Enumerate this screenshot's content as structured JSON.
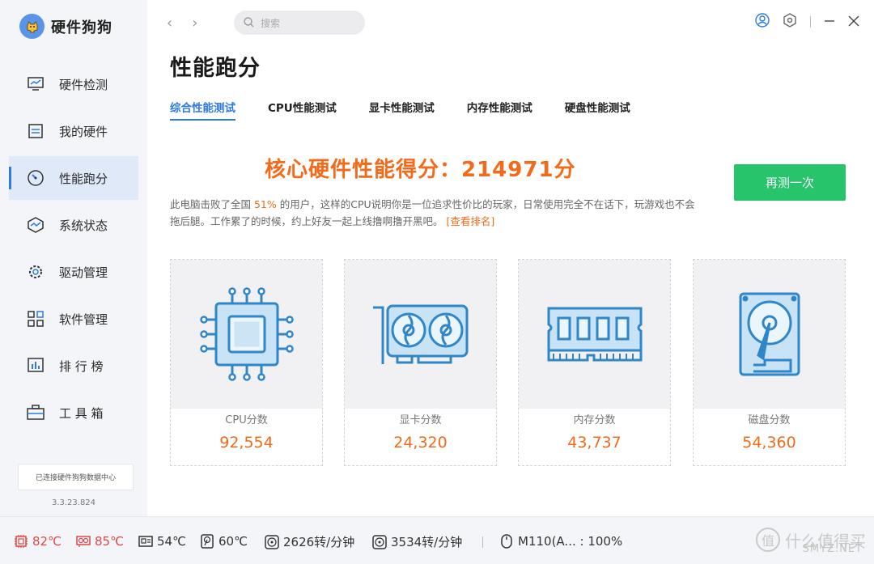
{
  "app": {
    "name": "硬件狗狗",
    "version": "3.3.23.824",
    "connection_status": "已连接硬件狗狗数据中心"
  },
  "sidebar": {
    "items": [
      {
        "label": "硬件检测",
        "icon": "monitor-chart-icon"
      },
      {
        "label": "我的硬件",
        "icon": "hardware-board-icon"
      },
      {
        "label": "性能跑分",
        "icon": "speedometer-icon",
        "active": true
      },
      {
        "label": "系统状态",
        "icon": "system-status-icon"
      },
      {
        "label": "驱动管理",
        "icon": "gear-icon"
      },
      {
        "label": "软件管理",
        "icon": "apps-grid-icon"
      },
      {
        "label": "排 行 榜",
        "icon": "bar-chart-icon"
      },
      {
        "label": "工 具 箱",
        "icon": "toolbox-icon"
      }
    ]
  },
  "topbar": {
    "search_placeholder": "搜索"
  },
  "main": {
    "title": "性能跑分",
    "tabs": [
      {
        "label": "综合性能测试",
        "active": true
      },
      {
        "label": "CPU性能测试"
      },
      {
        "label": "显卡性能测试"
      },
      {
        "label": "内存性能测试"
      },
      {
        "label": "硬盘性能测试"
      }
    ],
    "score_headline": "核心硬件性能得分：214971分",
    "retest_label": "再测一次",
    "desc_prefix": "此电脑击败了全国 ",
    "desc_percent": "51%",
    "desc_suffix": " 的用户，这样的CPU说明你是一位追求性价比的玩家，日常使用完全不在话下，玩游戏也不会拖后腿。工作累了的时候，约上好友一起上线撸啊撸开黑吧。",
    "ranking_link": "[查看排名]",
    "cards": [
      {
        "label": "CPU分数",
        "value": "92,554",
        "icon": "cpu-chip-icon"
      },
      {
        "label": "显卡分数",
        "value": "24,320",
        "icon": "graphics-card-icon"
      },
      {
        "label": "内存分数",
        "value": "43,737",
        "icon": "ram-module-icon"
      },
      {
        "label": "磁盘分数",
        "value": "54,360",
        "icon": "hard-disk-icon"
      }
    ]
  },
  "statusbar": {
    "cpu_temp": "82℃",
    "gpu_temp": "85℃",
    "board_temp": "54℃",
    "disk_temp": "60℃",
    "fan1": "2626转/分钟",
    "fan2": "3534转/分钟",
    "mouse_battery": "M110(A... : 100%"
  },
  "watermark": {
    "text": "什么值得买",
    "sub": "SMYZ.NET"
  },
  "colors": {
    "accent": "#2d7ae5",
    "score": "#f26a1a",
    "button": "#27c46c",
    "warn": "#e04848"
  }
}
